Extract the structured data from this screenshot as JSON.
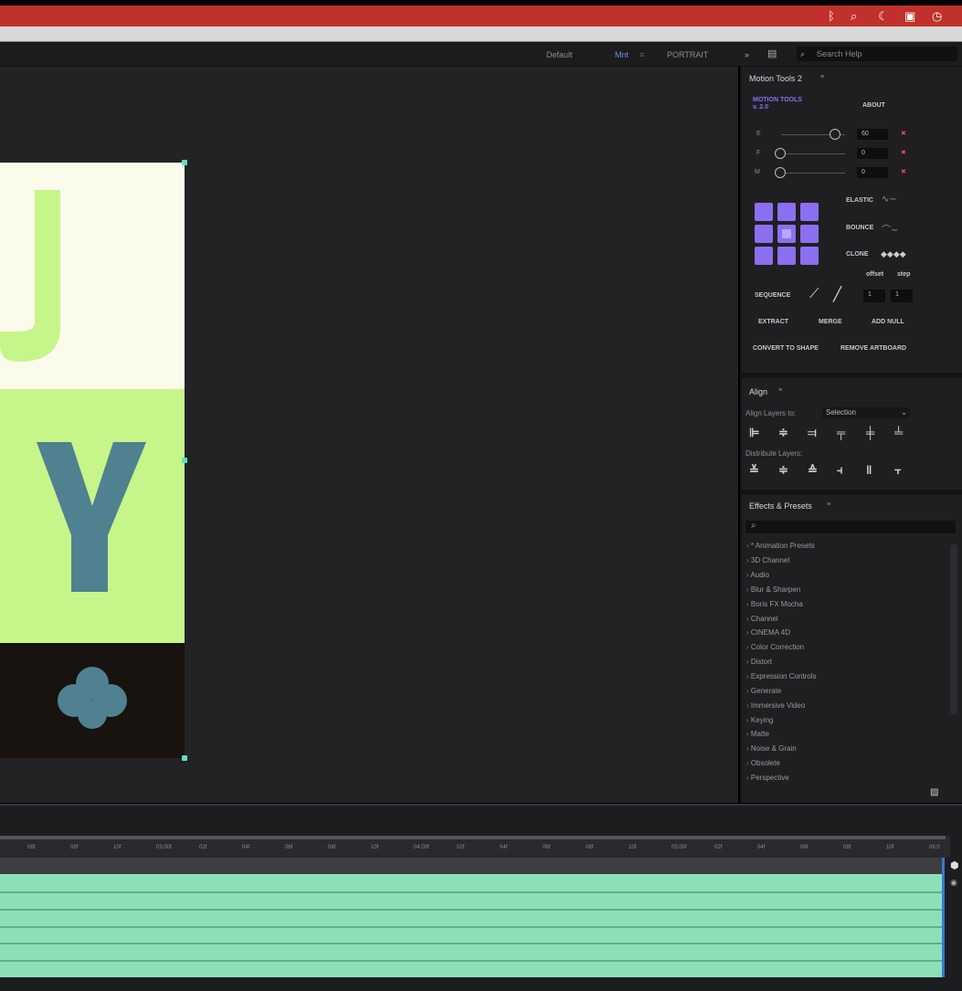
{
  "system_bar": {
    "icons": [
      "bluetooth-icon",
      "search-icon",
      "moon-icon",
      "drive-icon",
      "clock-icon"
    ],
    "glyphs": [
      "ᛒ",
      "⌕",
      "☾",
      "▣",
      "◷"
    ],
    "color": "#c0312b"
  },
  "workspaces": {
    "items": [
      "Default",
      "Mnt",
      "PORTRAIT"
    ],
    "active": "Mnt",
    "search_placeholder": "Search Help"
  },
  "motion_tools": {
    "title": "Motion Tools 2",
    "logo_text": "MOTION TOOLS v. 2.0",
    "about_label": "ABOUT",
    "sliders": [
      {
        "label": "E",
        "value": "60"
      },
      {
        "label": "F",
        "value": "0"
      },
      {
        "label": "M",
        "value": "0"
      }
    ],
    "elastic_label": "ELASTIC",
    "bounce_label": "BOUNCE",
    "clone_label": "CLONE",
    "offset_label": "offset",
    "step_label": "step",
    "sequence_label": "SEQUENCE",
    "offset_value": "1",
    "step_value": "1",
    "extract_label": "EXTRACT",
    "merge_label": "MERGE",
    "add_null_label": "ADD NULL",
    "convert_label": "CONVERT TO SHAPE",
    "remove_artboard_label": "REMOVE ARTBOARD"
  },
  "align": {
    "title": "Align",
    "align_to_label": "Align Layers to:",
    "align_to_value": "Selection",
    "distribute_label": "Distribute Layers:"
  },
  "effects": {
    "title": "Effects & Presets",
    "search_glyph": "⌕",
    "categories": [
      "* Animation Presets",
      "3D Channel",
      "Audio",
      "Blur & Sharpen",
      "Boris FX Mocha",
      "Channel",
      "CINEMA 4D",
      "Color Correction",
      "Distort",
      "Expression Controls",
      "Generate",
      "Immersive Video",
      "Keying",
      "Matte",
      "Noise & Grain",
      "Obsolete",
      "Perspective"
    ]
  },
  "artwork": {
    "letter_top": "U",
    "letter_mid": "Y",
    "colors": {
      "cream": "#fbfbec",
      "lime": "#c6f58a",
      "dark": "#18130e",
      "teal": "#4f8190",
      "mint_letter": "#c6f58a"
    }
  },
  "timeline": {
    "ticks": [
      "06f",
      "08f",
      "10f",
      "03:00f",
      "02f",
      "04f",
      "06f",
      "08f",
      "10f",
      "04:00f",
      "02f",
      "04f",
      "06f",
      "08f",
      "10f",
      "05:00f",
      "02f",
      "04f",
      "06f",
      "08f",
      "10f",
      "06:0"
    ],
    "track_color": "#8ce0b8",
    "track_count": 6
  }
}
